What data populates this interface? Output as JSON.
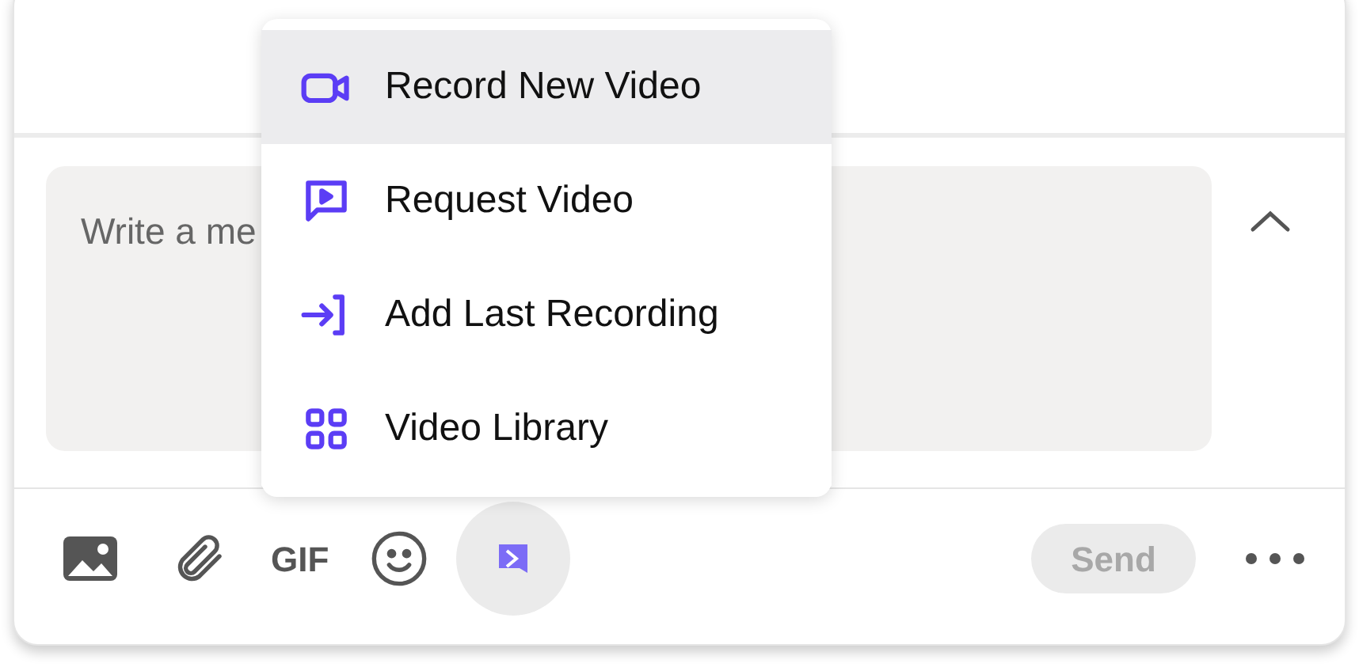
{
  "composer": {
    "placeholder": "Write a me",
    "expanded": false
  },
  "menu": {
    "items": [
      {
        "kind": "camera",
        "label": "Record New Video",
        "selected": true
      },
      {
        "kind": "request",
        "label": "Request Video",
        "selected": false
      },
      {
        "kind": "import",
        "label": "Add Last Recording",
        "selected": false
      },
      {
        "kind": "library",
        "label": "Video Library",
        "selected": false
      }
    ]
  },
  "toolbar": {
    "gif": "GIF",
    "video_active": true
  },
  "send": {
    "label": "Send",
    "disabled": true
  }
}
